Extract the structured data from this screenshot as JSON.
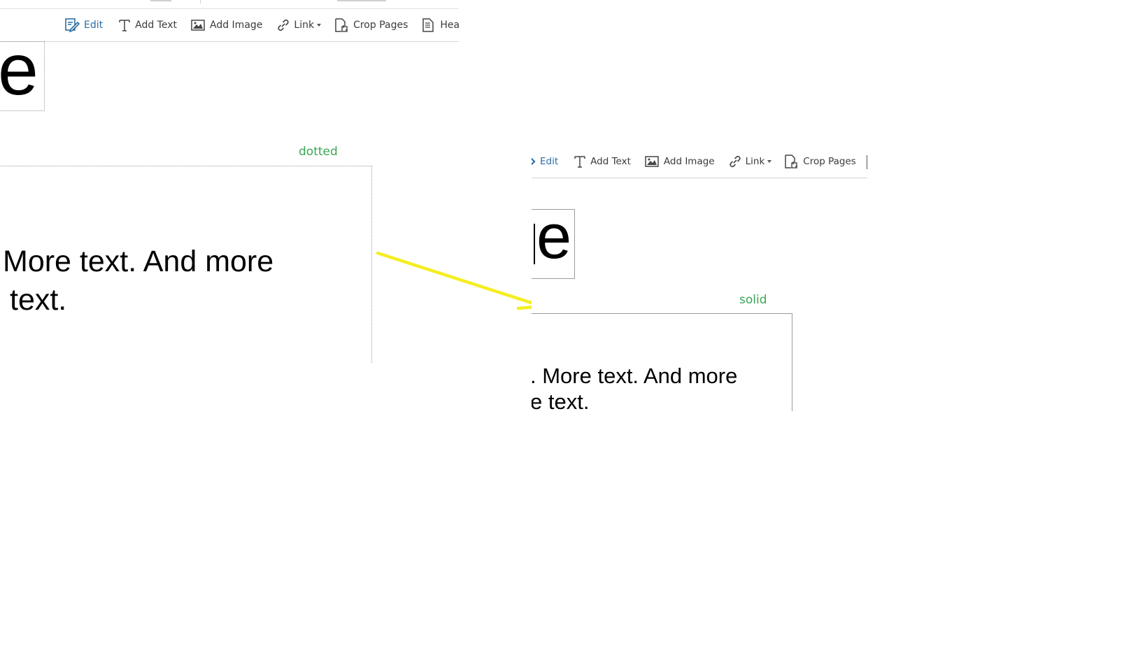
{
  "toolbar": {
    "edit": "Edit",
    "add_text": "Add Text",
    "add_image": "Add Image",
    "link": "Link",
    "crop_pages": "Crop Pages",
    "header": "Header &"
  },
  "left": {
    "heading_glyph": "e",
    "label": "dotted",
    "line1": "More text. And more",
    "line2": "text."
  },
  "right": {
    "heading_glyph": "e",
    "label": "solid",
    "line1": ". More text. And more",
    "line2": "e text."
  },
  "colors": {
    "accent": "#2b6ea5",
    "label_green": "#3aa655",
    "arrow": "#f4ee22"
  }
}
